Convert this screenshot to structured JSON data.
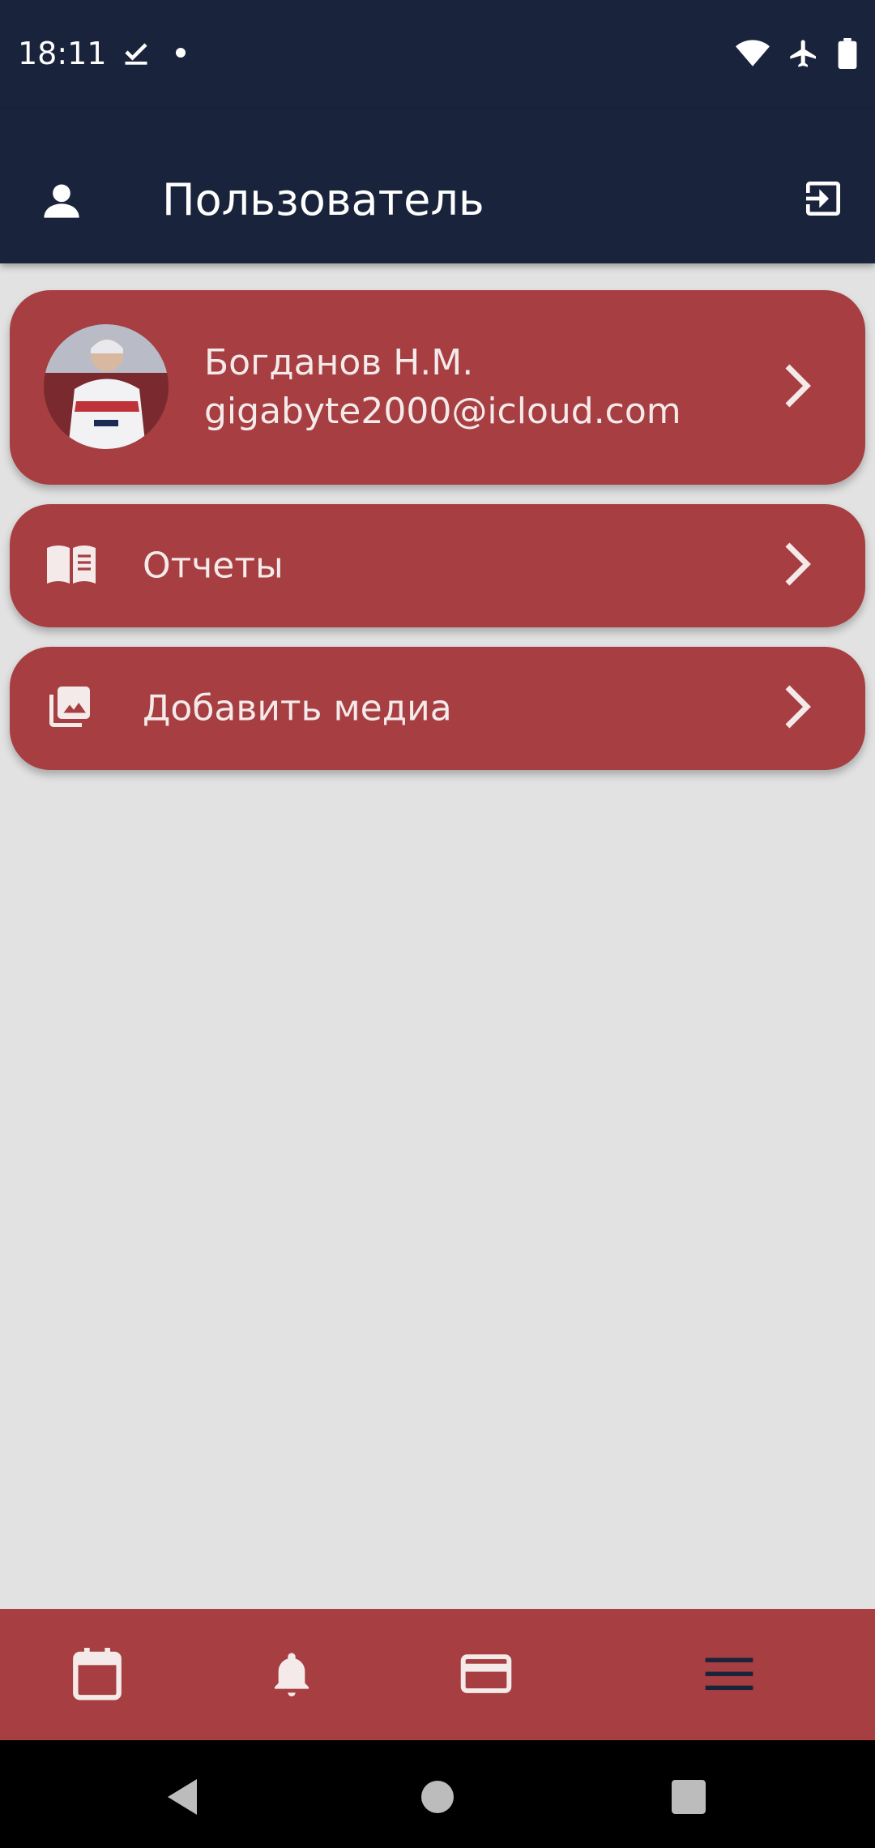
{
  "status_bar": {
    "time": "18:11",
    "icons_left": [
      "check-notification-icon",
      "dot-icon"
    ],
    "icons_right": [
      "wifi-icon",
      "airplane-icon",
      "battery-icon"
    ]
  },
  "app_bar": {
    "title": "Пользователь",
    "left_icon": "person-icon",
    "right_icon": "logout-icon"
  },
  "profile": {
    "name": "Богданов Н.М.",
    "email": "gigabyte2000@icloud.com"
  },
  "menu": {
    "items": [
      {
        "label": "Отчеты",
        "icon": "book-icon"
      },
      {
        "label": "Добавить медиа",
        "icon": "photo-library-icon"
      }
    ]
  },
  "bottom_nav": {
    "items": [
      "calendar-icon",
      "bell-icon",
      "card-icon",
      "menu-icon"
    ]
  },
  "colors": {
    "header": "#19233b",
    "card": "#a73e41",
    "background": "#e2e2e2",
    "nav_active": "#19233b"
  }
}
